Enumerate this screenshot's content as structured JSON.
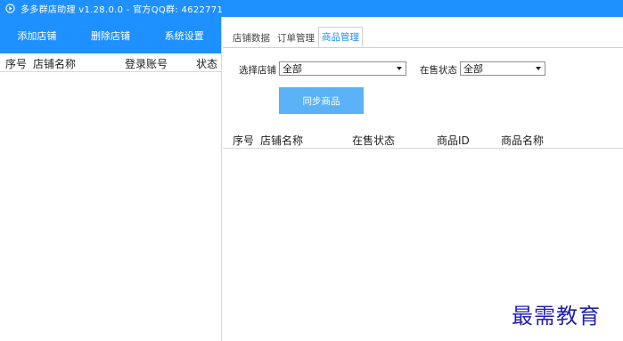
{
  "window": {
    "title": "多多群店助理 v1.28.0.0 - 官方QQ群: 4622771",
    "logo_icon": "play-circle-icon"
  },
  "toolbar": {
    "add_store": "添加店铺",
    "delete_store": "删除店铺",
    "settings": "系统设置"
  },
  "store_list": {
    "columns": [
      "序号",
      "店铺名称",
      "登录账号",
      "状态"
    ]
  },
  "tabs": [
    "店铺数据",
    "订单管理",
    "商品管理"
  ],
  "active_tab": "商品管理",
  "filters": {
    "store_label": "选择店铺",
    "store_value": "全部",
    "status_label": "在售状态",
    "status_value": "全部"
  },
  "sync_button": "同步商品",
  "product_grid": {
    "columns": [
      "序号",
      "店铺名称",
      "在售状态",
      "商品ID",
      "商品名称"
    ]
  },
  "watermark": "最需教育",
  "colors": {
    "accent": "#1e90ff",
    "sync_button": "#5ab1f5",
    "watermark": "#2323a8"
  }
}
